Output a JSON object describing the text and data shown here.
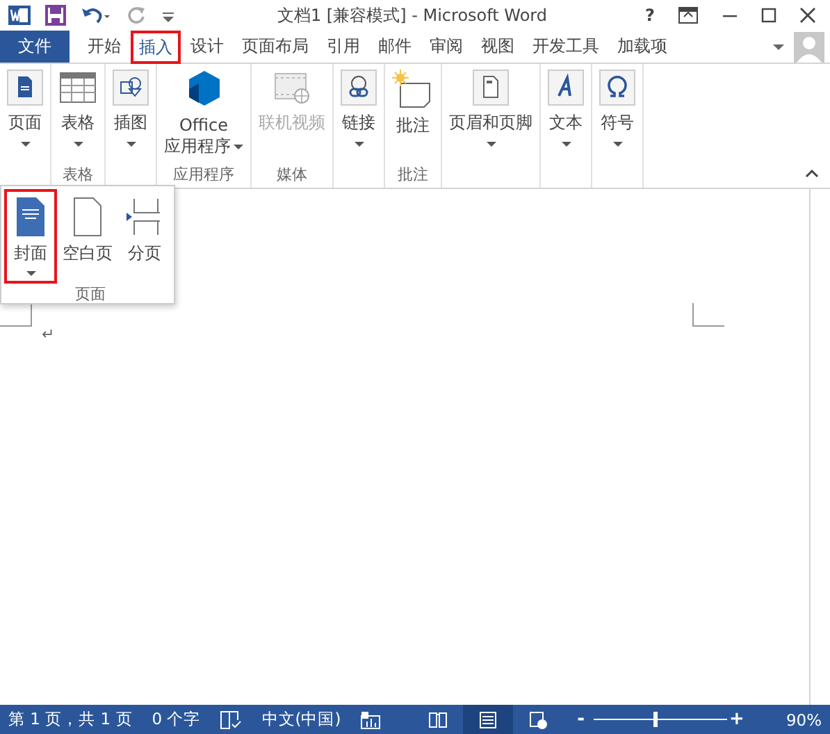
{
  "window": {
    "title": "文档1 [兼容模式] - Microsoft Word",
    "help": "?"
  },
  "file_tab": "文件",
  "tabs": [
    {
      "label": "开始",
      "selected": false,
      "highlighted": false
    },
    {
      "label": "插入",
      "selected": true,
      "highlighted": true
    },
    {
      "label": "设计",
      "selected": false,
      "highlighted": false
    },
    {
      "label": "页面布局",
      "selected": false,
      "highlighted": false
    },
    {
      "label": "引用",
      "selected": false,
      "highlighted": false
    },
    {
      "label": "邮件",
      "selected": false,
      "highlighted": false
    },
    {
      "label": "审阅",
      "selected": false,
      "highlighted": false
    },
    {
      "label": "视图",
      "selected": false,
      "highlighted": false
    },
    {
      "label": "开发工具",
      "selected": false,
      "highlighted": false
    },
    {
      "label": "加载项",
      "selected": false,
      "highlighted": false
    }
  ],
  "ribbon": {
    "groups": [
      {
        "buttons": [
          {
            "kind": "page",
            "lines": [
              "页面"
            ],
            "dropdown": true,
            "disabled": false
          }
        ]
      },
      {
        "label": "表格",
        "buttons": [
          {
            "kind": "table",
            "lines": [
              "表格"
            ],
            "dropdown": true,
            "disabled": false
          }
        ]
      },
      {
        "buttons": [
          {
            "kind": "illustration",
            "lines": [
              "插图"
            ],
            "dropdown": true,
            "disabled": false
          }
        ]
      },
      {
        "label": "应用程序",
        "buttons": [
          {
            "kind": "apps",
            "lines": [
              "Office",
              "应用程序"
            ],
            "dropdown": true,
            "disabled": false
          }
        ]
      },
      {
        "label": "媒体",
        "buttons": [
          {
            "kind": "video",
            "lines": [
              "联机视频"
            ],
            "dropdown": false,
            "disabled": true
          }
        ]
      },
      {
        "buttons": [
          {
            "kind": "link",
            "lines": [
              "链接"
            ],
            "dropdown": true,
            "disabled": false
          }
        ]
      },
      {
        "label": "批注",
        "buttons": [
          {
            "kind": "comment",
            "lines": [
              "批注"
            ],
            "dropdown": false,
            "disabled": false
          }
        ]
      },
      {
        "buttons": [
          {
            "kind": "header",
            "lines": [
              "页眉和页脚"
            ],
            "dropdown": true,
            "disabled": false
          }
        ]
      },
      {
        "buttons": [
          {
            "kind": "text",
            "lines": [
              "文本"
            ],
            "dropdown": true,
            "disabled": false
          }
        ]
      },
      {
        "buttons": [
          {
            "kind": "symbol",
            "lines": [
              "符号"
            ],
            "dropdown": true,
            "disabled": false
          }
        ]
      }
    ]
  },
  "dropdown": {
    "label": "页面",
    "items": [
      {
        "kind": "cover",
        "label": "封面",
        "dropdown": true,
        "highlighted": true
      },
      {
        "kind": "blank",
        "label": "空白页",
        "dropdown": false,
        "highlighted": false
      },
      {
        "kind": "break",
        "label": "分页",
        "dropdown": false,
        "highlighted": false
      }
    ]
  },
  "document": {
    "paragraph_mark": "↵"
  },
  "status_bar": {
    "page": "第 1 页，共 1 页",
    "words": "0 个字",
    "language": "中文(中国)",
    "views": [
      {
        "kind": "read",
        "selected": false
      },
      {
        "kind": "print",
        "selected": true
      },
      {
        "kind": "web",
        "selected": false
      }
    ],
    "zoom_minus": "-",
    "zoom_plus": "+",
    "zoom": {
      "level": 0.46
    },
    "zoom_reading": "90%"
  }
}
